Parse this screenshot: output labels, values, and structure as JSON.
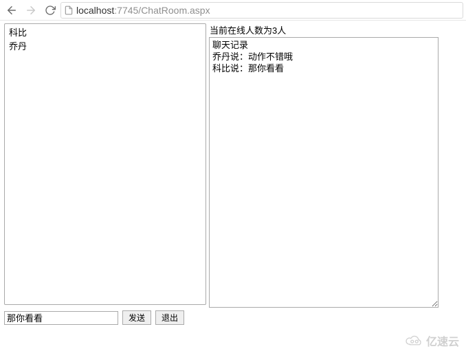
{
  "toolbar": {
    "url_host": "localhost",
    "url_rest": ":7745/ChatRoom.aspx"
  },
  "users": [
    "科比",
    "乔丹"
  ],
  "online_count_label": "当前在线人数为3人",
  "chat_log_header": "聊天记录",
  "chat_log": [
    "乔丹说：动作不错哦",
    "科比说：那你看看"
  ],
  "input": {
    "value": "那你看看",
    "send_label": "发送",
    "exit_label": "退出"
  },
  "watermark": "亿速云"
}
